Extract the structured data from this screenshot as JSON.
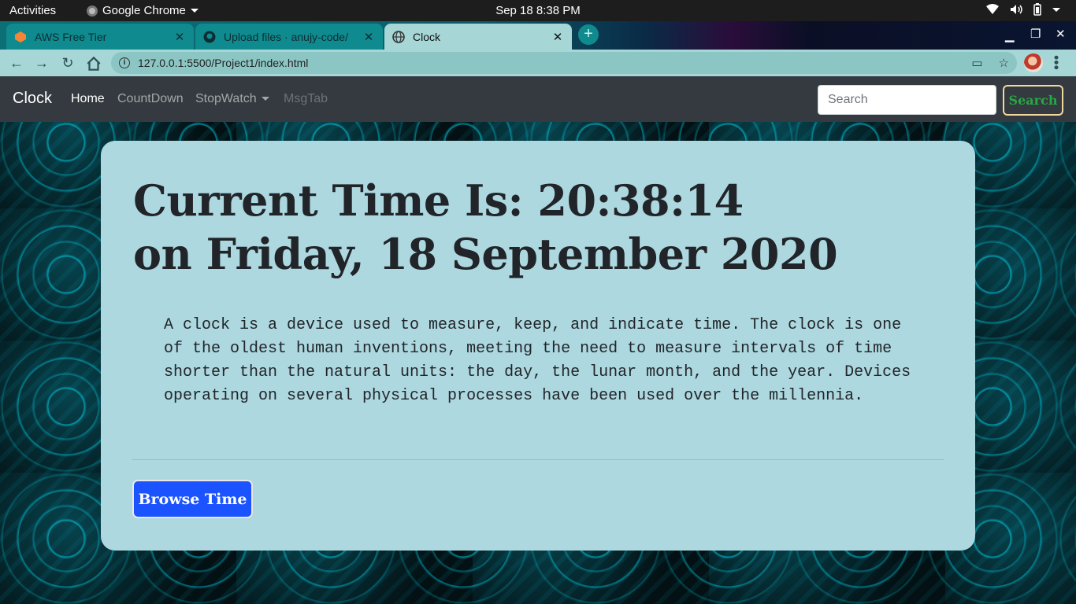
{
  "os": {
    "activities": "Activities",
    "app_menu": "Google Chrome",
    "clock": "Sep 18  8:38 PM"
  },
  "browser": {
    "tabs": [
      {
        "title": "AWS Free Tier",
        "icon": "aws-icon"
      },
      {
        "title": "Upload files · anujy-code/",
        "icon": "github-icon"
      },
      {
        "title": "Clock",
        "icon": "globe-icon",
        "active": true
      }
    ],
    "url": "127.0.0.1:5500/Project1/index.html"
  },
  "navbar": {
    "brand": "Clock",
    "links": [
      "Home",
      "CountDown",
      "StopWatch",
      "MsgTab"
    ],
    "search_placeholder": "Search",
    "search_button": "Search"
  },
  "jumbotron": {
    "time_line": "Current Time Is: 20:38:14",
    "date_line": "on Friday, 18 September 2020",
    "lead": "A clock is a device used to measure, keep, and indicate time. The clock is one of the oldest human inventions, meeting the need to measure intervals of time shorter than the natural units: the day, the lunar month, and the year. Devices operating on several physical processes have been used over the millennia.",
    "button": "Browse Time"
  },
  "colors": {
    "navbar_bg": "#343a40",
    "jumbotron_bg": "#add8e0",
    "primary_button": "#1a53ff",
    "search_text": "#28a745"
  }
}
